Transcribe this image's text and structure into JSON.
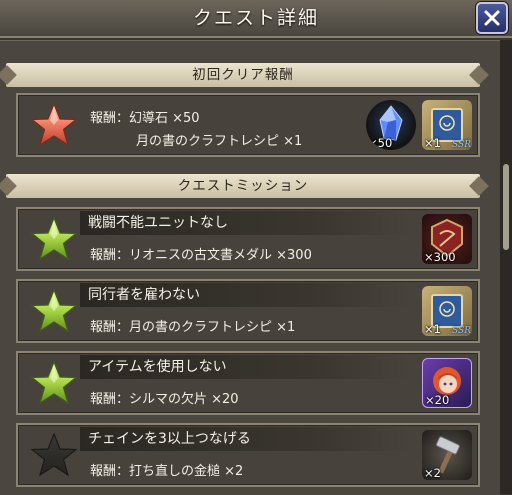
{
  "header": {
    "title": "クエスト詳細",
    "close_icon": "close-icon"
  },
  "sections": {
    "first_clear": "初回クリア報酬",
    "missions": "クエストミッション"
  },
  "first_clear_reward": {
    "line1": "報酬：幻導石 ×50",
    "line2": "月の書のクラフトレシピ ×1",
    "items": [
      {
        "icon": "crystal-icon",
        "qty": "50",
        "badge": ""
      },
      {
        "icon": "recipe-book-icon",
        "qty": "1",
        "badge": "SSR"
      }
    ]
  },
  "missions": [
    {
      "title": "戦闘不能ユニットなし",
      "reward": "報酬：リオニスの古文書メダル ×300",
      "achieved": true,
      "item_icon": "medal-icon",
      "qty": "300",
      "badge": ""
    },
    {
      "title": "同行者を雇わない",
      "reward": "報酬：月の書のクラフトレシピ ×1",
      "achieved": true,
      "item_icon": "recipe-book-icon",
      "qty": "1",
      "badge": "SSR"
    },
    {
      "title": "アイテムを使用しない",
      "reward": "報酬：シルマの欠片 ×20",
      "achieved": true,
      "item_icon": "character-portrait-icon",
      "qty": "20",
      "badge": ""
    },
    {
      "title": "チェインを3以上つなげる",
      "reward": "報酬：打ち直しの金槌 ×2",
      "achieved": false,
      "item_icon": "hammer-icon",
      "qty": "2",
      "badge": ""
    }
  ],
  "colors": {
    "star_first_clear": "#e8735f",
    "star_achieved": "#9ccf3e",
    "star_not_achieved": "#2e2c28"
  }
}
